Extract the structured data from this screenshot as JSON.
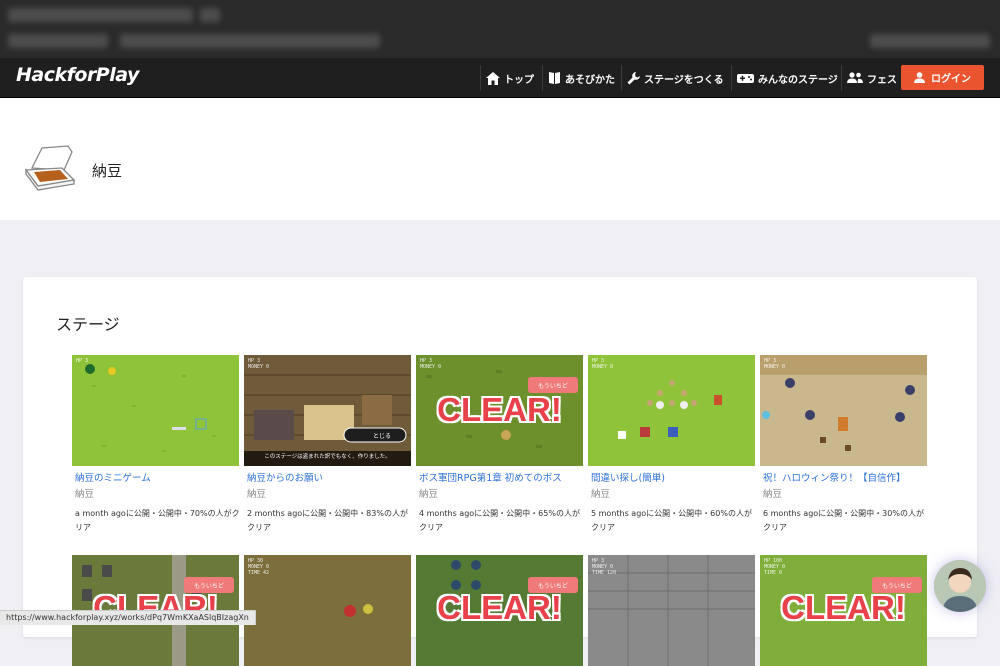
{
  "nav": {
    "logo": "HackforPlay",
    "items": [
      {
        "label": "トップ",
        "icon": "home-icon"
      },
      {
        "label": "あそびかた",
        "icon": "book-icon"
      },
      {
        "label": "ステージをつくる",
        "icon": "wrench-icon"
      },
      {
        "label": "みんなのステージ",
        "icon": "gamepad-icon"
      },
      {
        "label": "フェス",
        "icon": "people-icon"
      }
    ],
    "login_label": "ログイン",
    "login_color": "#ea5530"
  },
  "profile": {
    "name": "納豆",
    "avatar_icon": "natto-box-icon"
  },
  "section": {
    "title": "ステージ"
  },
  "works": [
    {
      "title": "納豆のミニゲーム",
      "author": "納豆",
      "meta": "a month agoに公開・公開中・70%の人がクリア",
      "cleared": false
    },
    {
      "title": "納豆からのお願い",
      "author": "納豆",
      "meta": "2 months agoに公開・公開中・83%の人がクリア",
      "cleared": false,
      "caption": "このステージは盗まれた訳でもなく、作りました。",
      "button": "とじる"
    },
    {
      "title": "ボス軍団RPG第1章 初めてのボス",
      "author": "納豆",
      "meta": "4 months agoに公開・公開中・65%の人がクリア",
      "cleared": true
    },
    {
      "title": "間違い探し(簡単)",
      "author": "納豆",
      "meta": "5 months agoに公開・公開中・60%の人がクリア",
      "cleared": false
    },
    {
      "title": "祝！ハロウィン祭り！【自信作】",
      "author": "納豆",
      "meta": "6 months agoに公開・公開中・30%の人がクリア",
      "cleared": false
    }
  ],
  "works_row2": [
    {
      "cleared": true
    },
    {
      "cleared": false
    },
    {
      "cleared": true
    },
    {
      "cleared": false
    },
    {
      "cleared": true
    }
  ],
  "clear_text": "CLEAR!",
  "remix_label": "もういちど",
  "status_url": "https://www.hackforplay.xyz/works/dPq7WmKXaASlqBIzagXn"
}
